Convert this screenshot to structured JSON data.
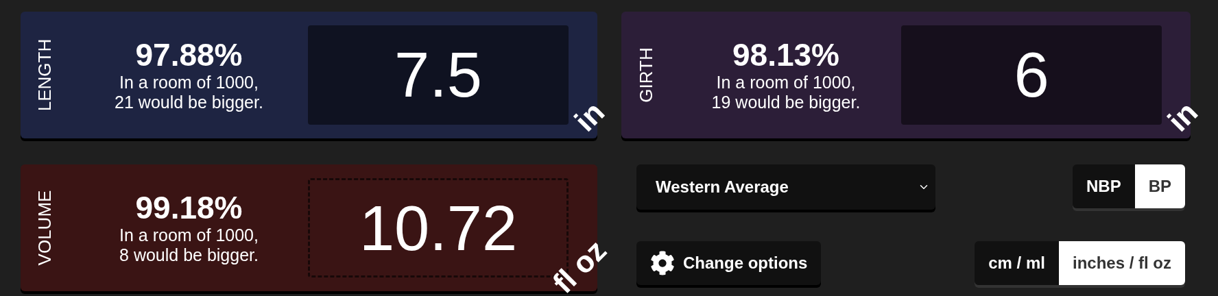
{
  "cards": [
    {
      "kind": "input",
      "label": "LENGTH",
      "color": "#1e2442",
      "percentile": "97.88%",
      "sentence": [
        "In a room of 1000,",
        "21 would be bigger."
      ],
      "value": "7.5",
      "unit": "in"
    },
    {
      "kind": "input",
      "label": "GIRTH",
      "color": "#2c1e38",
      "percentile": "98.13%",
      "sentence": [
        "In a room of 1000,",
        "19 would be bigger."
      ],
      "value": "6",
      "unit": "in"
    },
    {
      "kind": "computed",
      "label": "VOLUME",
      "color": "#3a1414",
      "percentile": "99.18%",
      "sentence": [
        "In a room of 1000,",
        "8 would be bigger."
      ],
      "value": "10.72",
      "unit": "fl oz"
    }
  ],
  "population_select": {
    "value": "Western Average"
  },
  "bp_toggle": [
    {
      "label": "NBP",
      "selected": false
    },
    {
      "label": "BP",
      "selected": true
    }
  ],
  "options_button": {
    "label": "Change options"
  },
  "unit_toggle": [
    {
      "label": "cm / ml",
      "selected": false
    },
    {
      "label": "inches / fl oz",
      "selected": true
    }
  ]
}
